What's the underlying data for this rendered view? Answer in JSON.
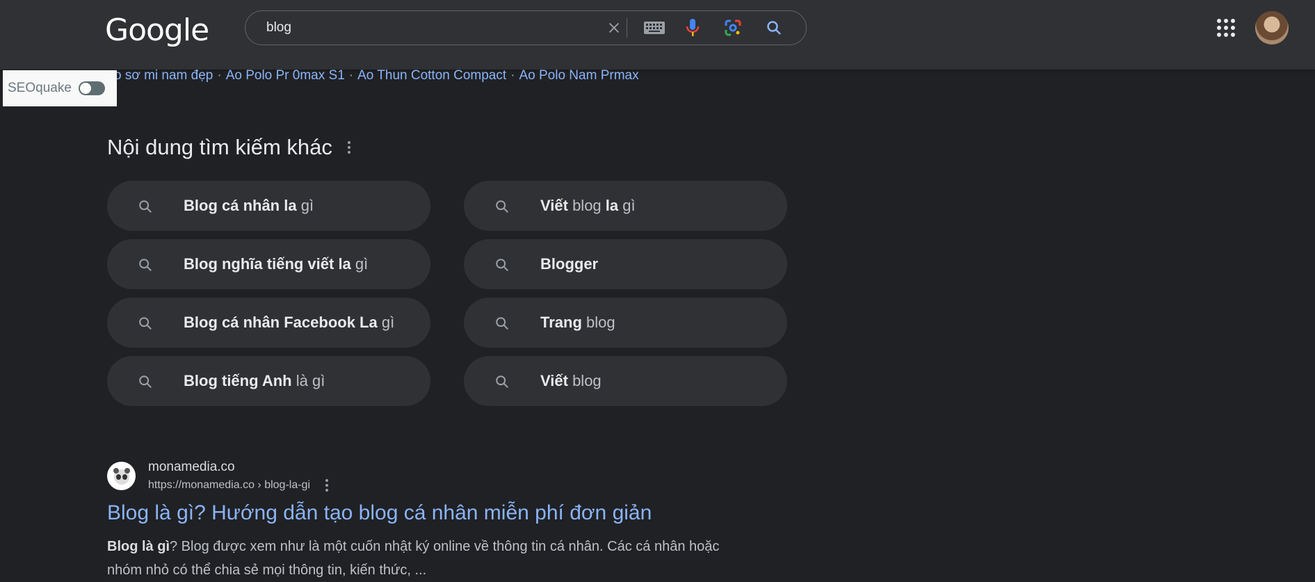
{
  "header": {
    "logo": "Google",
    "search_value": "blog",
    "icons": [
      "close-icon",
      "keyboard-icon",
      "mic-icon",
      "lens-icon",
      "search-icon",
      "apps-icon",
      "avatar"
    ]
  },
  "seoquake": {
    "label": "SEOquake",
    "enabled": false
  },
  "related_links": [
    "o sơ mi nam đẹp",
    "Ao Polo Pr 0max S1",
    "Ao Thun Cotton Compact",
    "Ao Polo Nam Prmax"
  ],
  "related_searches": {
    "heading": "Nội dung tìm kiếm khác",
    "items": [
      {
        "bold": "Blog cá nhân la",
        "rest": " gì"
      },
      {
        "bold": "Viết",
        "rest": " blog ",
        "bold2": "la",
        "rest2": " gì"
      },
      {
        "bold": "Blog nghĩa tiếng viết la",
        "rest": " gì"
      },
      {
        "bold": "Blogger",
        "rest": ""
      },
      {
        "bold": "Blog cá nhân Facebook La",
        "rest": " gì"
      },
      {
        "bold": "Trang",
        "rest": " blog"
      },
      {
        "bold": "Blog tiếng Anh",
        "rest": " là gì"
      },
      {
        "bold": "Viết",
        "rest": " blog"
      }
    ]
  },
  "result": {
    "site_name": "monamedia.co",
    "url": "https://monamedia.co › blog-la-gi",
    "title": "Blog là gì? Hướng dẫn tạo blog cá nhân miễn phí đơn giản",
    "snippet_bold": "Blog là gì",
    "snippet_rest": "? Blog được xem như là một cuốn nhật ký online về thông tin cá nhân. Các cá nhân hoặc nhóm nhỏ có thể chia sẻ mọi thông tin, kiến thức, ..."
  }
}
